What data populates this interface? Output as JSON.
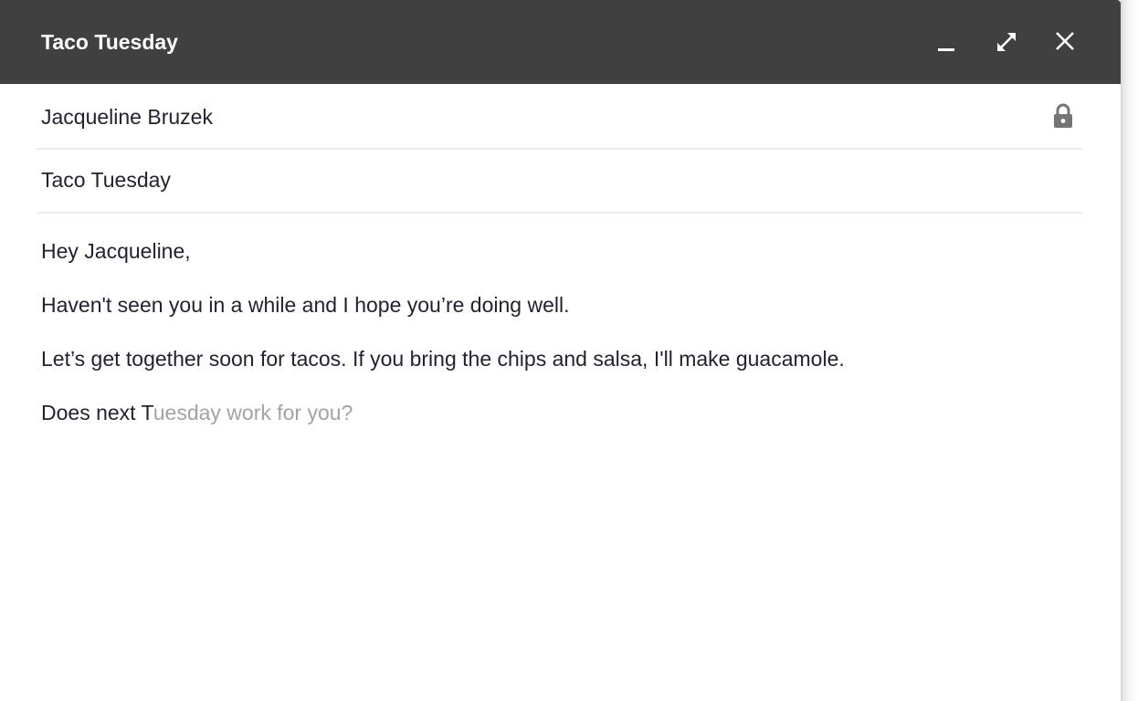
{
  "window": {
    "title": "Taco Tuesday",
    "controls": {
      "minimize_icon": "minimize-icon",
      "fullscreen_icon": "fullscreen-expand-icon",
      "close_icon": "close-icon"
    },
    "title_bar_color": "#404040"
  },
  "fields": {
    "recipients": "Jacqueline Bruzek",
    "recipients_icon": "lock-icon",
    "subject": "Taco Tuesday"
  },
  "body": {
    "greeting": "Hey Jacqueline,",
    "paragraph_1": "Haven't seen you in a while and I hope you’re doing well.",
    "paragraph_2": "Let’s get together soon for tacos. If you bring the chips and salsa, I'll make guacamole.",
    "typed_text": "Does next T",
    "smart_compose_suggestion": "uesday work for you?"
  },
  "colors": {
    "text": "#222236",
    "suggestion_text": "#a3a3a3",
    "divider": "#ececec"
  }
}
